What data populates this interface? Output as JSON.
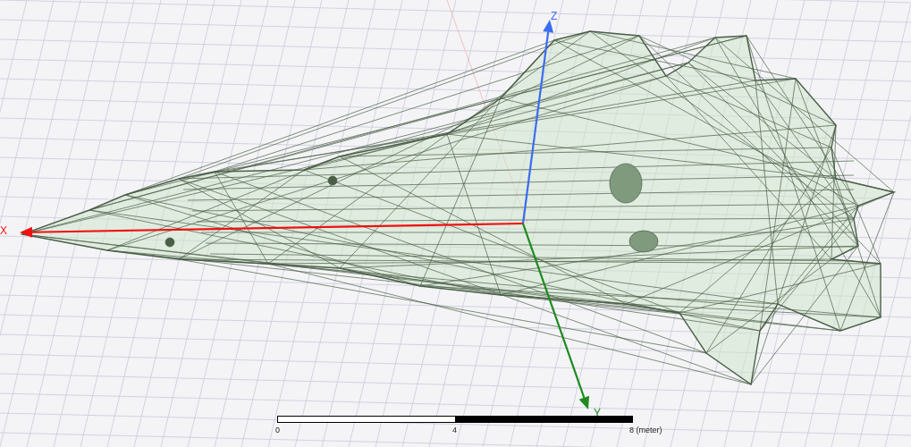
{
  "axes": [
    {
      "kind": "z",
      "label": "Z",
      "color": "#3c6cf0"
    },
    {
      "kind": "x",
      "label": "X",
      "color": "#ee1111"
    },
    {
      "kind": "y",
      "label": "Y",
      "color": "#1f8a1f"
    }
  ],
  "scale_bar": {
    "labels": [
      "0",
      "4",
      "8 (meter)"
    ]
  }
}
